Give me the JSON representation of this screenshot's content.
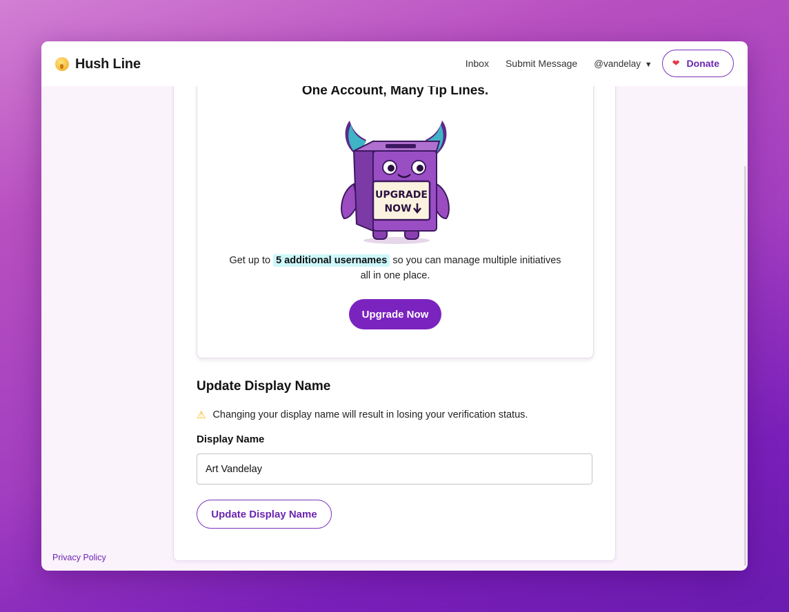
{
  "header": {
    "brand_name": "Hush Line",
    "brand_icon": "shushing-face-icon",
    "nav": {
      "inbox": "Inbox",
      "submit_message": "Submit Message",
      "username": "@vandelay",
      "user_caret": "▼",
      "donate": "Donate"
    }
  },
  "promo": {
    "title": "One Account, Many Tip Lines.",
    "sign_text_line1": "UPGRADE",
    "sign_text_line2": "NOW",
    "text_before": "Get up to ",
    "highlight": "5 additional usernames",
    "text_after": " so you can manage multiple initiatives all in one place.",
    "button": "Upgrade Now"
  },
  "display_name_section": {
    "title": "Update Display Name",
    "warning_icon": "warning-icon",
    "warning": "Changing your display name will result in losing your verification status.",
    "field_label": "Display Name",
    "field_value": "Art Vandelay",
    "button": "Update Display Name"
  },
  "footer": {
    "privacy": "Privacy Policy"
  },
  "colors": {
    "accent": "#7b23bf",
    "highlight": "#cdf7fb",
    "donate_heart": "#e33a4a"
  }
}
